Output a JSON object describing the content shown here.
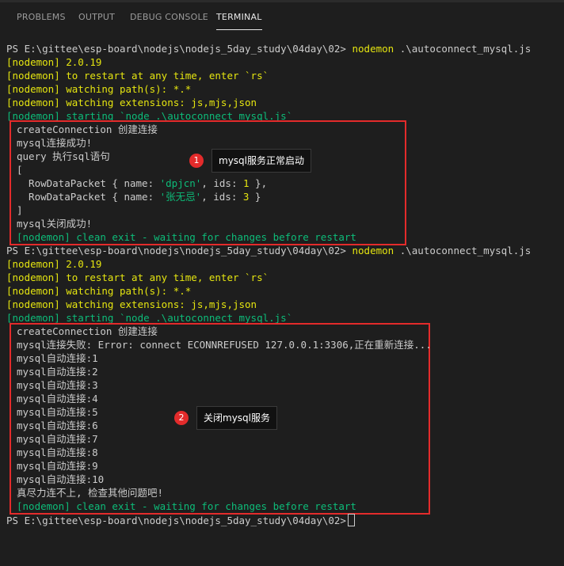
{
  "tabs": [
    {
      "label": "PROBLEMS"
    },
    {
      "label": "OUTPUT"
    },
    {
      "label": "DEBUG CONSOLE"
    },
    {
      "label": "TERMINAL"
    }
  ],
  "terminal": {
    "prompt": "PS E:\\gittee\\esp-board\\nodejs\\nodejs_5day_study\\04day\\02>",
    "cmd_name": "nodemon",
    "cmd_arg": ".\\autoconnect_mysql.js",
    "nodemon_version": "[nodemon] 2.0.19",
    "nodemon_restart": "[nodemon] to restart at any time, enter `rs`",
    "nodemon_watch": "[nodemon] watching path(s): *.*",
    "nodemon_ext": "[nodemon] watching extensions: js,mjs,json",
    "nodemon_start": "[nodemon] starting `node .\\autoconnect_mysql.js`",
    "run1": {
      "create": "createConnection 创建连接",
      "success": "mysql连接成功!",
      "query": "query 执行sql语句",
      "open_bracket": "[",
      "row1": {
        "prefix": "  RowDataPacket { name: ",
        "name": "'dpjcn'",
        "mid": ", ids: ",
        "ids": "1",
        "suffix": " },"
      },
      "row2": {
        "prefix": "  RowDataPacket { name: ",
        "name": "'张无忌'",
        "mid": ", ids: ",
        "ids": "3",
        "suffix": " }"
      },
      "close_bracket": "]",
      "closed": "mysql关闭成功!",
      "clean_exit": "[nodemon] clean exit - waiting for changes before restart"
    },
    "run2": {
      "create": "createConnection 创建连接",
      "fail": "mysql连接失败: Error: connect ECONNREFUSED 127.0.0.1:3306,正在重新连接...",
      "retries": [
        "mysql自动连接:1",
        "mysql自动连接:2",
        "mysql自动连接:3",
        "mysql自动连接:4",
        "mysql自动连接:5",
        "mysql自动连接:6",
        "mysql自动连接:7",
        "mysql自动连接:8",
        "mysql自动连接:9",
        "mysql自动连接:10"
      ],
      "giveup": "真尽力连不上, 检查其他问题吧!",
      "clean_exit": "[nodemon] clean exit - waiting for changes before restart"
    }
  },
  "annotations": [
    {
      "number": "1",
      "text": "mysql服务正常启动"
    },
    {
      "number": "2",
      "text": "关闭mysql服务"
    }
  ],
  "colors": {
    "background": "#1e1e1e",
    "text": "#cccccc",
    "yellow": "#e5e510",
    "green": "#0dbc79",
    "annotation_red": "#e32b2b"
  }
}
